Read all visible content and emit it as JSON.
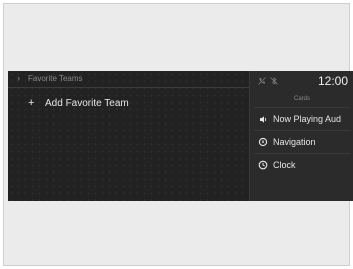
{
  "breadcrumb": {
    "label": "Favorite Teams"
  },
  "main": {
    "add_favorite_team_label": "Add Favorite Team"
  },
  "status_bar": {
    "time": "12:00",
    "icons": [
      "phone-muted-icon",
      "bluetooth-off-icon"
    ]
  },
  "cards": {
    "header": "Cards",
    "items": [
      {
        "label": "Now Playing Aud",
        "icon": "speaker-icon"
      },
      {
        "label": "Navigation",
        "icon": "navigation-icon"
      },
      {
        "label": "Clock",
        "icon": "clock-icon"
      }
    ]
  }
}
